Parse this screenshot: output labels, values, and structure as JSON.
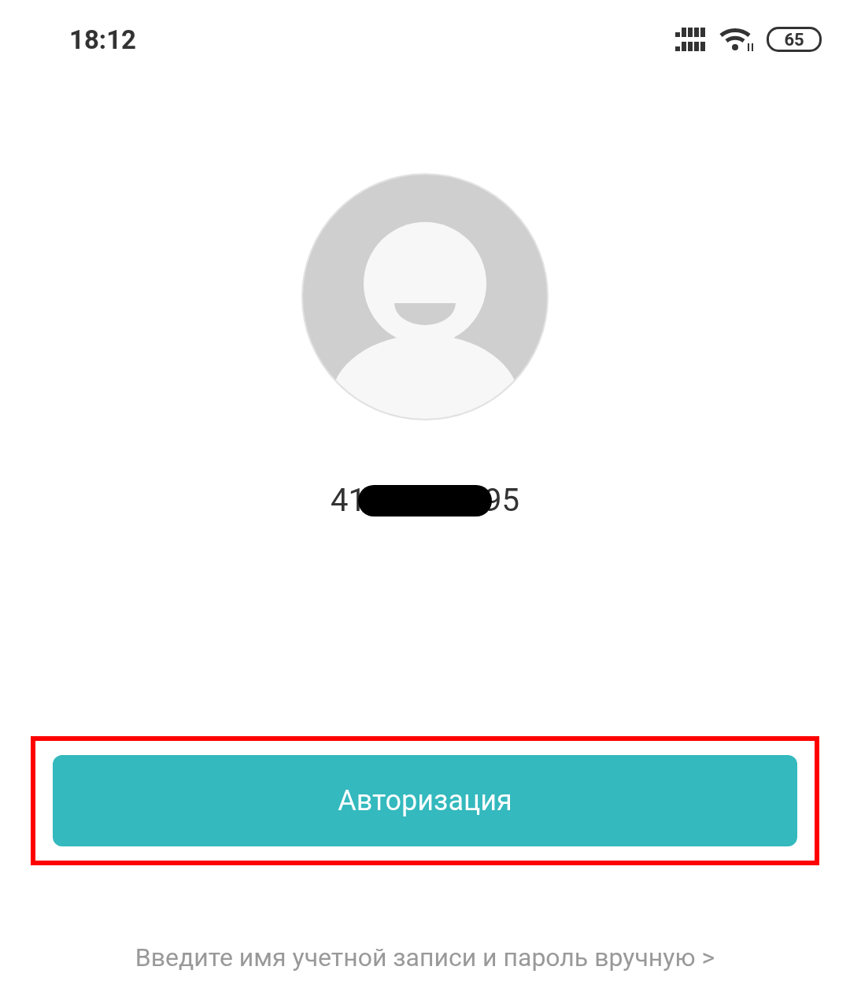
{
  "status_bar": {
    "time": "18:12",
    "battery": "65"
  },
  "account": {
    "number_start": "41",
    "number_end": "95",
    "redacted": true
  },
  "login_button": {
    "label": "Авторизация",
    "highlighted": true
  },
  "manual_link": {
    "label": "Введите имя учетной записи и пароль вручную >"
  }
}
